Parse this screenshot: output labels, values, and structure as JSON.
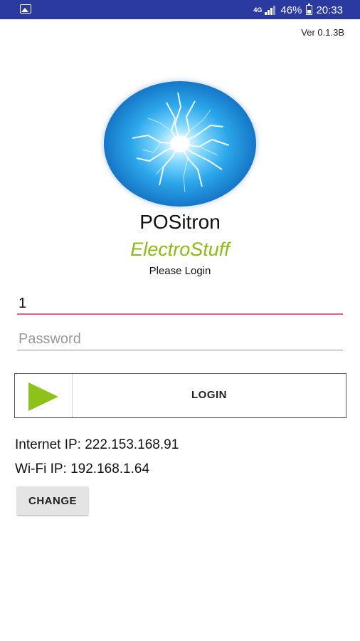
{
  "status_bar": {
    "network": "4G",
    "battery": "46%",
    "time": "20:33"
  },
  "version": "Ver 0.1.3B",
  "app": {
    "name": "POSitron",
    "brand": "ElectroStuff",
    "prompt": "Please Login"
  },
  "form": {
    "user_value": "1",
    "password_placeholder": "Password",
    "login_label": "LOGIN"
  },
  "network_info": {
    "internet_ip": "Internet IP: 222.153.168.91",
    "wifi_ip": "Wi-Fi IP: 192.168.1.64"
  },
  "change_label": "CHANGE",
  "colors": {
    "status_bar": "#2a3aa0",
    "brand": "#8cbb13",
    "play_icon": "#8cc21a",
    "user_underline": "#e0637c"
  }
}
